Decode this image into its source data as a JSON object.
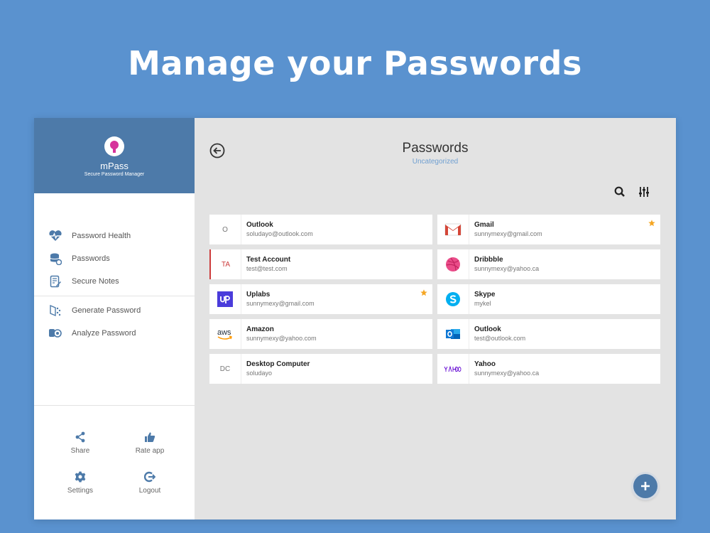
{
  "headline": "Manage your Passwords",
  "brand": {
    "name": "mPass",
    "tagline": "Secure Password Manager"
  },
  "nav": [
    {
      "label": "Password Health",
      "icon": "heart-pulse-icon"
    },
    {
      "label": "Passwords",
      "icon": "database-icon"
    },
    {
      "label": "Secure Notes",
      "icon": "note-icon"
    },
    {
      "label": "Generate Password",
      "icon": "generate-icon"
    },
    {
      "label": "Analyze Password",
      "icon": "analyze-icon"
    }
  ],
  "actions": [
    {
      "label": "Share",
      "icon": "share-icon"
    },
    {
      "label": "Rate app",
      "icon": "thumbs-up-icon"
    },
    {
      "label": "Settings",
      "icon": "gear-icon"
    },
    {
      "label": "Logout",
      "icon": "logout-icon"
    }
  ],
  "main": {
    "title": "Passwords",
    "subtitle": "Uncategorized"
  },
  "accounts": [
    {
      "initials": "O",
      "title": "Outlook",
      "subtitle": "soludayo@outlook.com",
      "starred": false
    },
    {
      "icon": "gmail-icon",
      "title": "Gmail",
      "subtitle": "sunnymexy@gmail.com",
      "starred": true
    },
    {
      "initials": "TA",
      "title": "Test Account",
      "subtitle": "test@test.com",
      "starred": false
    },
    {
      "icon": "dribbble-icon",
      "title": "Dribbble",
      "subtitle": "sunnymexy@yahoo.ca",
      "starred": false
    },
    {
      "icon": "uplabs-icon",
      "title": "Uplabs",
      "subtitle": "sunnymexy@gmail.com",
      "starred": true
    },
    {
      "icon": "skype-icon",
      "title": "Skype",
      "subtitle": "mykel",
      "starred": false
    },
    {
      "icon": "amazon-icon",
      "title": "Amazon",
      "subtitle": "sunnymexy@yahoo.com",
      "starred": false
    },
    {
      "icon": "outlook-icon",
      "title": "Outlook",
      "subtitle": "test@outlook.com",
      "starred": false
    },
    {
      "initials": "DC",
      "title": "Desktop Computer",
      "subtitle": "soludayo",
      "starred": false
    },
    {
      "icon": "yahoo-icon",
      "title": "Yahoo",
      "subtitle": "sunnymexy@yahoo.ca",
      "starred": false
    }
  ],
  "colors": {
    "background": "#5a92cf",
    "brand": "#4d7aa9",
    "star": "#f5a623",
    "accent_red": "#cc3b3b"
  }
}
